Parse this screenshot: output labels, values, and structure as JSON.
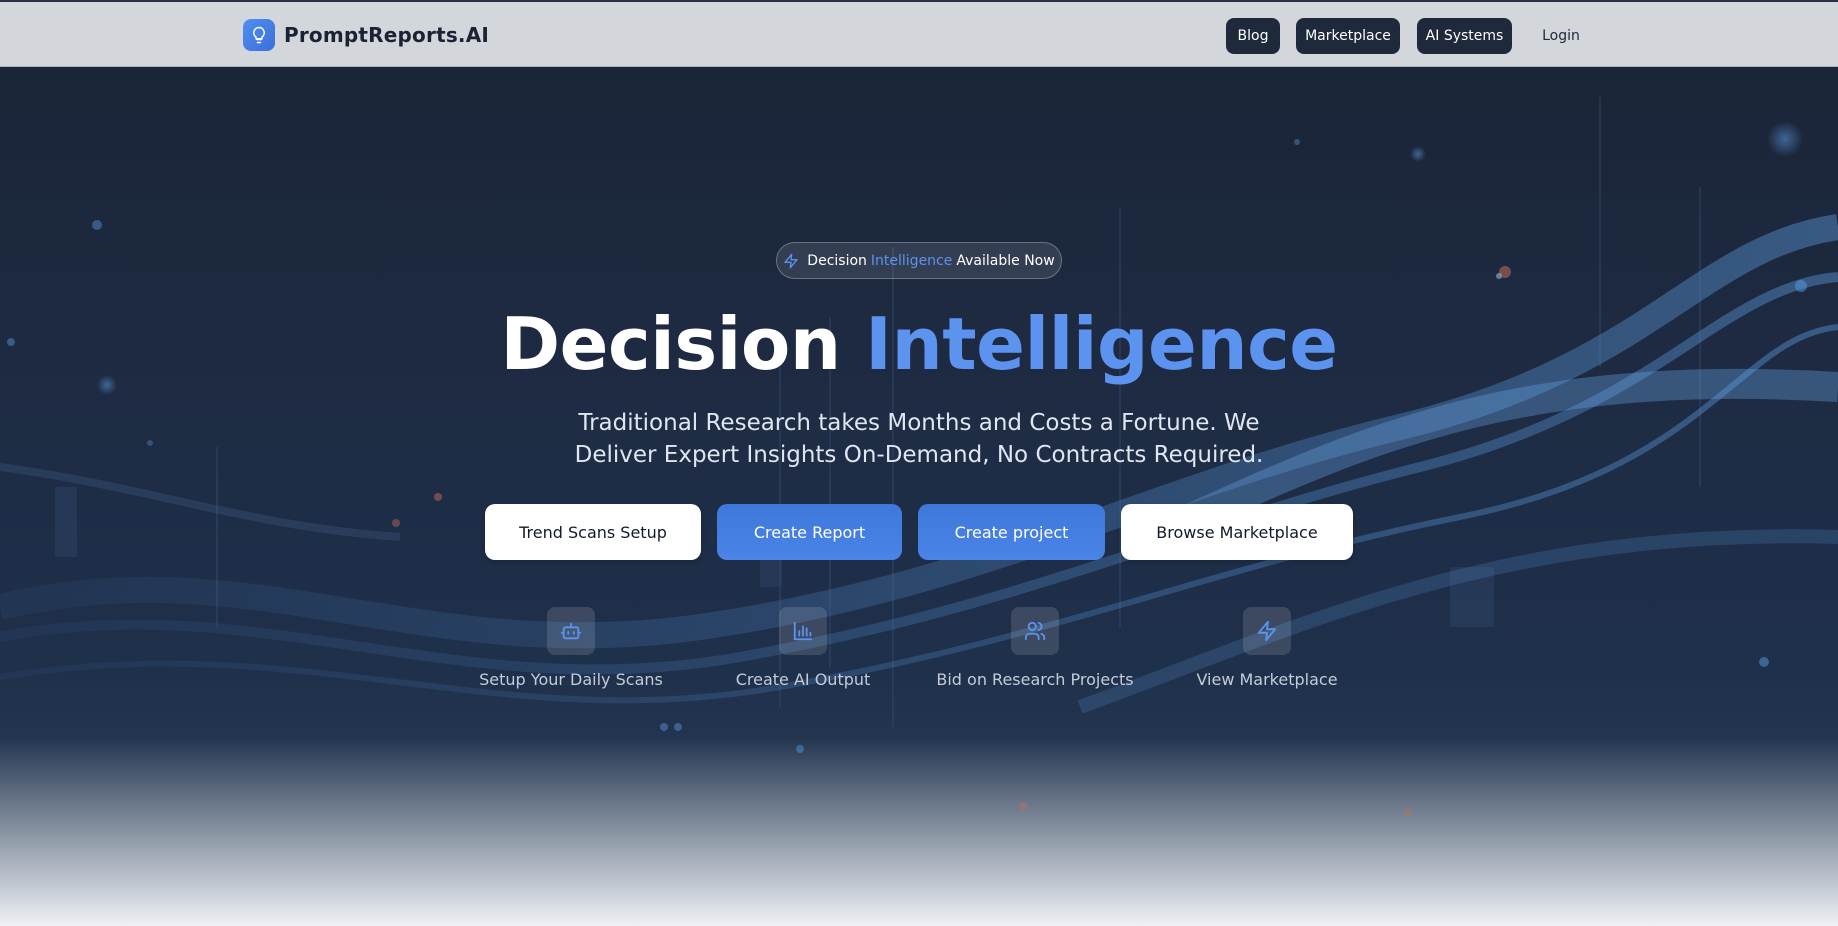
{
  "brand": {
    "name": "PromptReports.AI",
    "icon": "lightbulb-icon",
    "accent_color": "#4f8ff0"
  },
  "nav": {
    "blog_label": "Blog",
    "marketplace_label": "Marketplace",
    "ai_systems_label": "AI Systems",
    "login_label": "Login"
  },
  "hero": {
    "badge": {
      "icon": "lightning-icon",
      "prefix": "Decision",
      "highlight": "Intelligence",
      "suffix": "Available Now"
    },
    "headline_main": "Decision",
    "headline_accent": "Intelligence",
    "subtitle": "Traditional Research takes Months and Costs a Fortune. We Deliver Expert Insights On-Demand, No Contracts Required.",
    "buttons": [
      {
        "label": "Trend Scans Setup",
        "style": "light"
      },
      {
        "label": "Create Report",
        "style": "blue"
      },
      {
        "label": "Create project",
        "style": "blue"
      },
      {
        "label": "Browse Marketplace",
        "style": "light"
      }
    ],
    "features": [
      {
        "label": "Setup Your Daily Scans",
        "icon": "robot-icon"
      },
      {
        "label": "Create AI Output",
        "icon": "bar-chart-icon"
      },
      {
        "label": "Bid on Research Projects",
        "icon": "users-icon"
      },
      {
        "label": "View Marketplace",
        "icon": "lightning-icon"
      }
    ]
  },
  "colors": {
    "hero_background": "#1e2c45",
    "accent_blue": "#5b93ef",
    "nav_button": "#1e293b",
    "navbar_background": "#d3d6db"
  }
}
